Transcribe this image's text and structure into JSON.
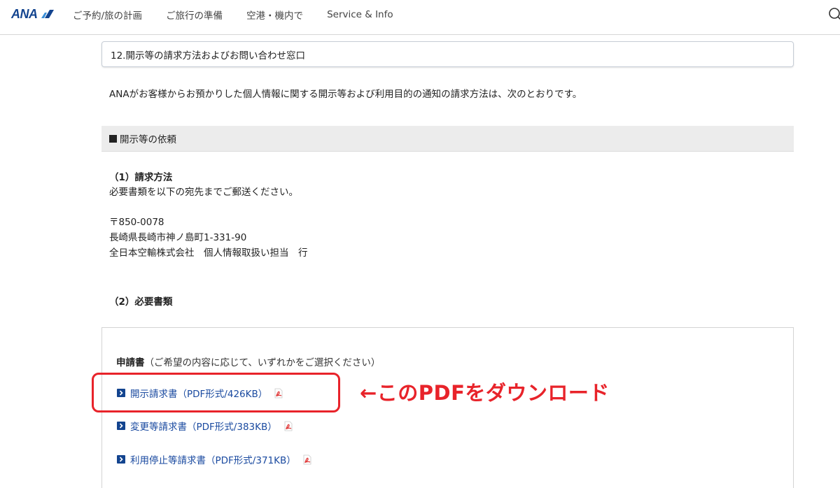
{
  "header": {
    "logo_text": "ANA",
    "nav": [
      {
        "label": "ご予約/旅の計画"
      },
      {
        "label": "ご旅行の準備"
      },
      {
        "label": "空港・機内で"
      },
      {
        "label": "Service & Info"
      }
    ],
    "search_icon": "search-icon"
  },
  "section": {
    "title": "12.開示等の請求方法およびお問い合わせ窓口",
    "intro": "ANAがお客様からお預かりした個人情報に関する開示等および利用目的の通知の請求方法は、次のとおりです。",
    "subheading": "開示等の依頼"
  },
  "method": {
    "heading": "（1）請求方法",
    "instruction": "必要書類を以下の宛先までご郵送ください。",
    "postal_code": "〒850-0078",
    "address": "長崎県長崎市神ノ島町1-331-90",
    "recipient": "全日本空輸株式会社　個人情報取扱い担当　行"
  },
  "documents": {
    "heading": "（2）必要書類",
    "form_label": "申請書",
    "form_note": "（ご希望の内容に応じて、いずれかをご選択ください）",
    "links": [
      {
        "label": "開示請求書（PDF形式/426KB）"
      },
      {
        "label": "変更等請求書（PDF形式/383KB）"
      },
      {
        "label": "利用停止等請求書（PDF形式/371KB）"
      }
    ]
  },
  "annotation": {
    "text": "←このPDFをダウンロード",
    "color": "#e8232a"
  },
  "colors": {
    "brand": "#13448f",
    "link": "#1a4aa0"
  }
}
